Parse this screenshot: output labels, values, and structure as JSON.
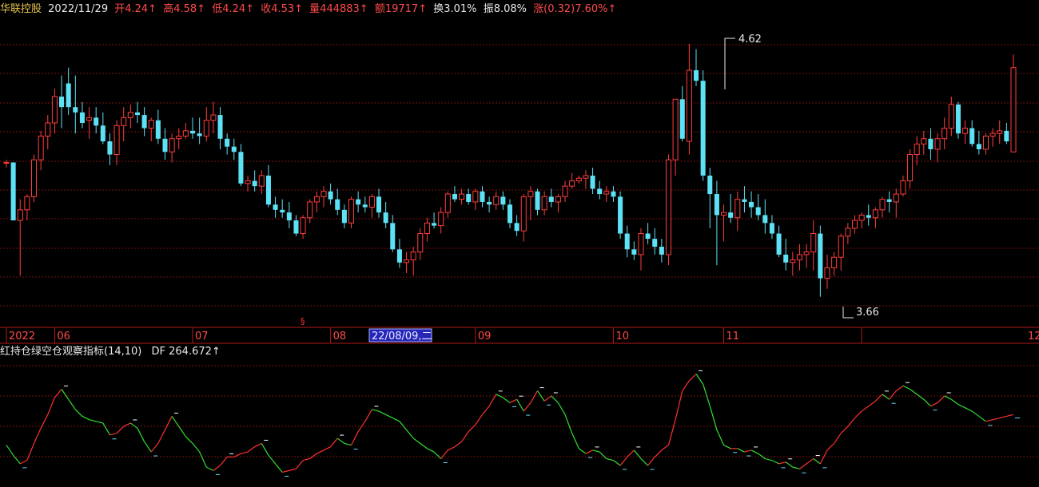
{
  "header": {
    "name": "华联控股",
    "date": "2022/11/29",
    "open": "开4.24↑",
    "high": "高4.58↑",
    "low": "低4.24↑",
    "close": "收4.53↑",
    "volume": "量444883↑",
    "amount": "额19717↑",
    "turnover": "换3.01%",
    "amplitude": "振8.08%",
    "change": "涨(0.32)7.60%↑"
  },
  "indicator": {
    "title": "红持仓绿空仓观察指标(14,10)",
    "df": "DF 264.672↑"
  },
  "annotations": {
    "high": "4.62",
    "low": "3.66"
  },
  "time_axis": {
    "labels": [
      {
        "text": "2022",
        "i": 0
      },
      {
        "text": "06",
        "i": 7
      },
      {
        "text": "07",
        "i": 27
      },
      {
        "text": "08",
        "i": 47
      },
      {
        "text": "09",
        "i": 68
      },
      {
        "text": "10",
        "i": 88
      },
      {
        "text": "11",
        "i": 104
      },
      {
        "text": "12",
        "i": 124
      }
    ],
    "cursor_label": "22/08/09,二",
    "cursor_i": 54
  },
  "colors": {
    "up": "#ff3d3d",
    "down": "#5ce1f5",
    "grid": "#7a1010",
    "axis": "#b01818",
    "rise": "#ff3030",
    "fall": "#30e030"
  },
  "chart_data": {
    "type": "candlestick",
    "ylim": [
      3.55,
      4.72
    ],
    "candles": [
      [
        4.17,
        4.18,
        4.15,
        4.17
      ],
      [
        4.17,
        4.17,
        3.95,
        3.95
      ],
      [
        3.95,
        4.03,
        3.74,
        3.99
      ],
      [
        3.99,
        4.05,
        3.95,
        4.04
      ],
      [
        4.04,
        4.2,
        4.02,
        4.18
      ],
      [
        4.18,
        4.29,
        4.14,
        4.27
      ],
      [
        4.27,
        4.35,
        4.22,
        4.32
      ],
      [
        4.32,
        4.45,
        4.28,
        4.42
      ],
      [
        4.42,
        4.5,
        4.3,
        4.38
      ],
      [
        4.47,
        4.53,
        4.35,
        4.38
      ],
      [
        4.38,
        4.5,
        4.28,
        4.36
      ],
      [
        4.36,
        4.4,
        4.3,
        4.32
      ],
      [
        4.33,
        4.38,
        4.26,
        4.34
      ],
      [
        4.34,
        4.38,
        4.28,
        4.31
      ],
      [
        4.31,
        4.36,
        4.24,
        4.25
      ],
      [
        4.25,
        4.28,
        4.16,
        4.2
      ],
      [
        4.2,
        4.33,
        4.16,
        4.31
      ],
      [
        4.31,
        4.38,
        4.25,
        4.34
      ],
      [
        4.34,
        4.39,
        4.3,
        4.36
      ],
      [
        4.36,
        4.4,
        4.32,
        4.35
      ],
      [
        4.35,
        4.38,
        4.27,
        4.3
      ],
      [
        4.3,
        4.34,
        4.25,
        4.33
      ],
      [
        4.33,
        4.37,
        4.24,
        4.26
      ],
      [
        4.26,
        4.3,
        4.18,
        4.21
      ],
      [
        4.21,
        4.28,
        4.17,
        4.26
      ],
      [
        4.26,
        4.3,
        4.22,
        4.27
      ],
      [
        4.27,
        4.32,
        4.26,
        4.29
      ],
      [
        4.29,
        4.34,
        4.26,
        4.28
      ],
      [
        4.28,
        4.34,
        4.24,
        4.27
      ],
      [
        4.27,
        4.38,
        4.25,
        4.33
      ],
      [
        4.33,
        4.4,
        4.28,
        4.35
      ],
      [
        4.35,
        4.38,
        4.22,
        4.26
      ],
      [
        4.26,
        4.28,
        4.2,
        4.23
      ],
      [
        4.23,
        4.26,
        4.18,
        4.21
      ],
      [
        4.21,
        4.24,
        4.08,
        4.09
      ],
      [
        4.09,
        4.12,
        4.06,
        4.1
      ],
      [
        4.1,
        4.14,
        4.06,
        4.08
      ],
      [
        4.08,
        4.14,
        4.05,
        4.12
      ],
      [
        4.12,
        4.16,
        4.0,
        4.01
      ],
      [
        4.01,
        4.04,
        3.96,
        3.99
      ],
      [
        3.99,
        4.03,
        3.96,
        3.98
      ],
      [
        3.98,
        4.02,
        3.92,
        3.95
      ],
      [
        3.95,
        3.97,
        3.89,
        3.9
      ],
      [
        3.9,
        3.97,
        3.88,
        3.96
      ],
      [
        3.96,
        4.03,
        3.94,
        4.02
      ],
      [
        4.02,
        4.06,
        3.98,
        4.04
      ],
      [
        4.04,
        4.08,
        4.0,
        4.06
      ],
      [
        4.06,
        4.09,
        4.01,
        4.03
      ],
      [
        4.03,
        4.07,
        3.97,
        3.99
      ],
      [
        3.99,
        4.01,
        3.92,
        3.94
      ],
      [
        3.94,
        4.04,
        3.92,
        4.03
      ],
      [
        4.03,
        4.06,
        3.98,
        4.01
      ],
      [
        4.01,
        4.04,
        3.98,
        4.0
      ],
      [
        4.0,
        4.05,
        3.96,
        4.04
      ],
      [
        4.04,
        4.07,
        3.96,
        3.98
      ],
      [
        3.98,
        4.02,
        3.92,
        3.94
      ],
      [
        3.94,
        3.97,
        3.83,
        3.84
      ],
      [
        3.84,
        3.88,
        3.77,
        3.79
      ],
      [
        3.79,
        3.83,
        3.75,
        3.8
      ],
      [
        3.8,
        3.85,
        3.74,
        3.83
      ],
      [
        3.83,
        3.92,
        3.8,
        3.9
      ],
      [
        3.9,
        3.96,
        3.87,
        3.94
      ],
      [
        3.94,
        3.98,
        3.92,
        3.93
      ],
      [
        3.93,
        4.0,
        3.9,
        3.98
      ],
      [
        3.98,
        4.06,
        3.96,
        4.05
      ],
      [
        4.05,
        4.08,
        4.02,
        4.03
      ],
      [
        4.03,
        4.07,
        4.01,
        4.05
      ],
      [
        4.05,
        4.07,
        4.01,
        4.02
      ],
      [
        4.02,
        4.07,
        3.99,
        4.06
      ],
      [
        4.06,
        4.08,
        4.0,
        4.02
      ],
      [
        4.02,
        4.04,
        3.98,
        4.01
      ],
      [
        4.01,
        4.06,
        3.99,
        4.04
      ],
      [
        4.04,
        4.06,
        3.99,
        4.01
      ],
      [
        4.01,
        4.03,
        3.92,
        3.94
      ],
      [
        3.94,
        3.97,
        3.89,
        3.91
      ],
      [
        3.91,
        4.05,
        3.87,
        4.04
      ],
      [
        4.04,
        4.08,
        3.95,
        4.06
      ],
      [
        4.06,
        4.07,
        3.97,
        3.99
      ],
      [
        3.99,
        4.06,
        3.97,
        4.04
      ],
      [
        4.04,
        4.07,
        4.0,
        4.02
      ],
      [
        4.02,
        4.05,
        3.98,
        4.04
      ],
      [
        4.04,
        4.1,
        4.02,
        4.08
      ],
      [
        4.08,
        4.13,
        4.07,
        4.1
      ],
      [
        4.1,
        4.12,
        4.09,
        4.11
      ],
      [
        4.11,
        4.14,
        4.07,
        4.12
      ],
      [
        4.12,
        4.15,
        4.05,
        4.07
      ],
      [
        4.07,
        4.1,
        4.03,
        4.05
      ],
      [
        4.05,
        4.08,
        4.02,
        4.06
      ],
      [
        4.06,
        4.08,
        4.02,
        4.04
      ],
      [
        4.04,
        4.06,
        3.88,
        3.9
      ],
      [
        3.9,
        3.93,
        3.81,
        3.84
      ],
      [
        3.84,
        3.87,
        3.8,
        3.82
      ],
      [
        3.82,
        3.92,
        3.76,
        3.9
      ],
      [
        3.9,
        3.94,
        3.86,
        3.88
      ],
      [
        3.88,
        3.92,
        3.82,
        3.85
      ],
      [
        3.85,
        3.88,
        3.79,
        3.82
      ],
      [
        3.82,
        4.2,
        3.78,
        4.18
      ],
      [
        4.18,
        4.4,
        4.12,
        4.41
      ],
      [
        4.41,
        4.46,
        4.25,
        4.26
      ],
      [
        4.25,
        4.62,
        4.2,
        4.52
      ],
      [
        4.52,
        4.6,
        4.46,
        4.48
      ],
      [
        4.48,
        4.52,
        4.1,
        4.12
      ],
      [
        4.12,
        4.15,
        3.92,
        4.05
      ],
      [
        4.05,
        4.1,
        3.78,
        3.97
      ],
      [
        3.97,
        4.01,
        3.87,
        3.98
      ],
      [
        3.98,
        4.05,
        3.94,
        3.96
      ],
      [
        3.96,
        4.06,
        3.91,
        4.03
      ],
      [
        4.03,
        4.08,
        3.98,
        4.02
      ],
      [
        4.02,
        4.06,
        3.96,
        4.0
      ],
      [
        4.0,
        4.05,
        3.95,
        3.97
      ],
      [
        3.97,
        4.03,
        3.9,
        3.94
      ],
      [
        3.94,
        3.97,
        3.88,
        3.9
      ],
      [
        3.9,
        3.93,
        3.81,
        3.82
      ],
      [
        3.82,
        3.88,
        3.76,
        3.79
      ],
      [
        3.79,
        3.83,
        3.74,
        3.8
      ],
      [
        3.8,
        3.86,
        3.76,
        3.82
      ],
      [
        3.82,
        3.86,
        3.77,
        3.83
      ],
      [
        3.83,
        3.95,
        3.76,
        3.9
      ],
      [
        3.9,
        3.93,
        3.66,
        3.73
      ],
      [
        3.73,
        3.82,
        3.69,
        3.77
      ],
      [
        3.77,
        3.83,
        3.74,
        3.81
      ],
      [
        3.81,
        3.9,
        3.76,
        3.89
      ],
      [
        3.89,
        3.94,
        3.86,
        3.92
      ],
      [
        3.92,
        3.97,
        3.9,
        3.95
      ],
      [
        3.95,
        3.98,
        3.92,
        3.97
      ],
      [
        3.97,
        4.01,
        3.93,
        3.96
      ],
      [
        3.96,
        4.0,
        3.92,
        3.99
      ],
      [
        3.99,
        4.04,
        3.96,
        4.03
      ],
      [
        4.03,
        4.06,
        3.98,
        4.02
      ],
      [
        4.02,
        4.07,
        3.96,
        4.05
      ],
      [
        4.05,
        4.12,
        4.04,
        4.1
      ],
      [
        4.1,
        4.22,
        4.07,
        4.2
      ],
      [
        4.2,
        4.27,
        4.16,
        4.24
      ],
      [
        4.24,
        4.29,
        4.2,
        4.26
      ],
      [
        4.26,
        4.3,
        4.18,
        4.22
      ],
      [
        4.22,
        4.28,
        4.17,
        4.26
      ],
      [
        4.26,
        4.34,
        4.22,
        4.3
      ],
      [
        4.3,
        4.42,
        4.27,
        4.39
      ],
      [
        4.39,
        4.4,
        4.26,
        4.28
      ],
      [
        4.28,
        4.33,
        4.24,
        4.3
      ],
      [
        4.3,
        4.33,
        4.23,
        4.24
      ],
      [
        4.24,
        4.29,
        4.2,
        4.22
      ],
      [
        4.22,
        4.28,
        4.2,
        4.27
      ],
      [
        4.27,
        4.3,
        4.23,
        4.28
      ],
      [
        4.28,
        4.33,
        4.24,
        4.29
      ],
      [
        4.29,
        4.32,
        4.24,
        4.25
      ],
      [
        4.21,
        4.58,
        4.21,
        4.53
      ]
    ],
    "indicator": [
      120,
      114,
      109,
      111,
      121,
      130,
      138,
      148,
      153,
      147,
      141,
      137,
      135,
      134,
      133,
      126,
      127,
      131,
      133,
      130,
      122,
      116,
      121,
      129,
      137,
      131,
      125,
      121,
      116,
      107,
      105,
      108,
      113,
      113,
      115,
      116,
      119,
      121,
      114,
      109,
      104,
      105,
      106,
      111,
      112,
      115,
      117,
      119,
      124,
      121,
      120,
      128,
      134,
      141,
      140,
      138,
      136,
      134,
      129,
      124,
      121,
      118,
      116,
      112,
      117,
      119,
      122,
      128,
      132,
      138,
      143,
      150,
      148,
      145,
      147,
      140,
      145,
      152,
      146,
      149,
      145,
      138,
      127,
      118,
      115,
      117,
      116,
      112,
      111,
      108,
      113,
      117,
      112,
      108,
      113,
      117,
      120,
      135,
      152,
      158,
      162,
      156,
      143,
      129,
      120,
      118,
      118,
      116,
      117,
      115,
      112,
      111,
      109,
      110,
      107,
      106,
      109,
      112,
      109,
      117,
      121,
      127,
      131,
      136,
      140,
      143,
      146,
      150,
      147,
      152,
      155,
      153,
      150,
      147,
      143,
      145,
      149,
      147,
      144,
      142,
      140,
      137,
      134,
      135,
      136,
      137,
      138
    ]
  }
}
